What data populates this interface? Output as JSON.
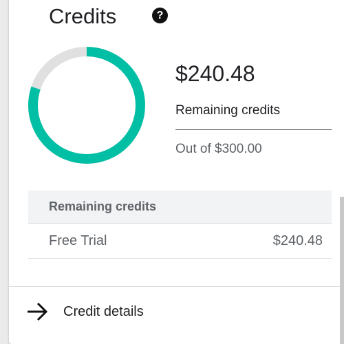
{
  "card": {
    "title": "Credits",
    "help_icon": "help-circle-icon"
  },
  "summary": {
    "remaining_amount": "$240.48",
    "remaining_label": "Remaining credits",
    "total_label": "Out of $300.00",
    "remaining_fraction": 0.8016
  },
  "chart_colors": {
    "remaining": "#00bfa5",
    "used": "#e0e0e0"
  },
  "table": {
    "header": "Remaining credits",
    "rows": [
      {
        "name": "Free Trial",
        "value": "$240.48"
      }
    ]
  },
  "footer": {
    "link_label": "Credit details",
    "link_icon": "arrow-right-icon"
  }
}
